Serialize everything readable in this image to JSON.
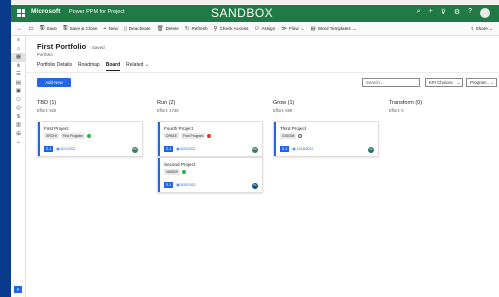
{
  "topbar": {
    "brand": "Microsoft",
    "app_name": "Power PPM for Project",
    "environment": "SANDBOX"
  },
  "commands": [
    {
      "icon": "back-arrow-icon",
      "label": ""
    },
    {
      "icon": "popout-icon",
      "label": ""
    },
    {
      "icon": "save-icon",
      "label": "Save"
    },
    {
      "icon": "save-close-icon",
      "label": "Save & Close"
    },
    {
      "icon": "plus-icon",
      "label": "New"
    },
    {
      "icon": "deactivate-icon",
      "label": "Deactivate"
    },
    {
      "icon": "delete-icon",
      "label": "Delete"
    },
    {
      "icon": "refresh-icon",
      "label": "Refresh"
    },
    {
      "icon": "check-access-icon",
      "label": "Check Access"
    },
    {
      "icon": "assign-icon",
      "label": "Assign"
    },
    {
      "icon": "flow-icon",
      "label": "Flow"
    },
    {
      "icon": "word-templates-icon",
      "label": "Word Templates"
    }
  ],
  "share_label": "Share",
  "record": {
    "title": "First Portfolio",
    "saved": "- Saved",
    "entity": "Portfolio"
  },
  "tabs": [
    "Portfolio Details",
    "Roadmap",
    "Board",
    "Related"
  ],
  "active_tab": "Board",
  "add_new": "Add New",
  "search_placeholder": "Search...",
  "filters": [
    "KPI Choices",
    "Program..."
  ],
  "columns": [
    {
      "title": "TBD (1)",
      "effort": "Effort: 920"
    },
    {
      "title": "Run (2)",
      "effort": "Effort: 1738"
    },
    {
      "title": "Grow (1)",
      "effort": "Effort: 590"
    },
    {
      "title": "Transform (0)",
      "effort": "Effort: 0"
    }
  ],
  "cards": [
    {
      "title": "First Project",
      "tag1": "SRCHI",
      "tag2": "Find Program",
      "status_color": "#2fb344",
      "chip": "S-1",
      "date": "6/21/2022",
      "avatar": "PA",
      "avatar_color": "#3c7a5b"
    },
    {
      "title": "Fourth Project",
      "tag1": "DR61E",
      "tag2": "Find Program",
      "status_color": "#e0352b",
      "chip": "S-1",
      "date": "6/22/2022",
      "avatar": "PA",
      "avatar_color": "#3c7a5b"
    },
    {
      "title": "Second Project",
      "tag1": "VA5509",
      "tag2": "",
      "status_color": "#2fb344",
      "chip": "S-1",
      "date": "8/25/2022",
      "avatar": "PA",
      "avatar_color": "#0f4c81"
    },
    {
      "title": "Third Project",
      "tag1": "GS5308",
      "tag2": "",
      "status_color": "",
      "chip": "S-1",
      "date": "11/18/2022",
      "avatar": "PA",
      "avatar_color": "#2a6f6a"
    }
  ]
}
